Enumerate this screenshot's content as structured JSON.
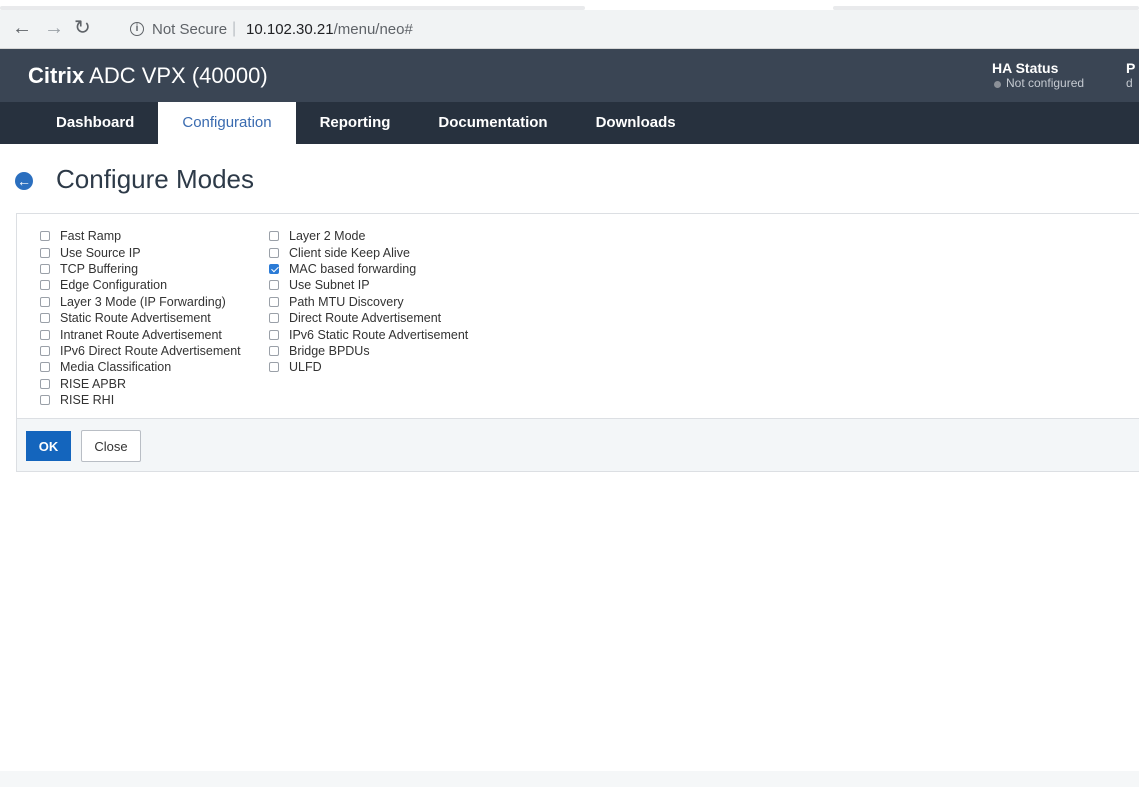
{
  "browser": {
    "not_secure": "Not Secure",
    "url_host": "10.102.30.21",
    "url_path": "/menu/neo#"
  },
  "header": {
    "brand_bold": "Citrix",
    "brand_rest": " ADC VPX (40000)",
    "ha_status_label": "HA Status",
    "ha_status_value": "Not configured",
    "cut_label": "P",
    "cut_value": "d"
  },
  "nav": {
    "tabs": [
      {
        "label": "Dashboard"
      },
      {
        "label": "Configuration"
      },
      {
        "label": "Reporting"
      },
      {
        "label": "Documentation"
      },
      {
        "label": "Downloads"
      }
    ],
    "active": "Configuration"
  },
  "page": {
    "title": "Configure Modes"
  },
  "modes": {
    "col1": [
      {
        "label": "Fast Ramp",
        "checked": false
      },
      {
        "label": "Use Source IP",
        "checked": false
      },
      {
        "label": "TCP Buffering",
        "checked": false
      },
      {
        "label": "Edge Configuration",
        "checked": false
      },
      {
        "label": "Layer 3 Mode (IP Forwarding)",
        "checked": false
      },
      {
        "label": "Static Route Advertisement",
        "checked": false
      },
      {
        "label": "Intranet Route Advertisement",
        "checked": false
      },
      {
        "label": "IPv6 Direct Route Advertisement",
        "checked": false
      },
      {
        "label": "Media Classification",
        "checked": false
      },
      {
        "label": "RISE APBR",
        "checked": false
      },
      {
        "label": "RISE RHI",
        "checked": false
      }
    ],
    "col2": [
      {
        "label": "Layer 2 Mode",
        "checked": false
      },
      {
        "label": "Client side Keep Alive",
        "checked": false
      },
      {
        "label": "MAC based forwarding",
        "checked": true
      },
      {
        "label": "Use Subnet IP",
        "checked": false
      },
      {
        "label": "Path MTU Discovery",
        "checked": false
      },
      {
        "label": "Direct Route Advertisement",
        "checked": false
      },
      {
        "label": "IPv6 Static Route Advertisement",
        "checked": false
      },
      {
        "label": "Bridge BPDUs",
        "checked": false
      },
      {
        "label": "ULFD",
        "checked": false
      }
    ]
  },
  "buttons": {
    "ok": "OK",
    "close": "Close"
  },
  "colors": {
    "header_bg": "#3a4554",
    "nav_bg": "#27313e",
    "accent": "#1465bd",
    "checkbox_checked": "#2b7bd6"
  }
}
